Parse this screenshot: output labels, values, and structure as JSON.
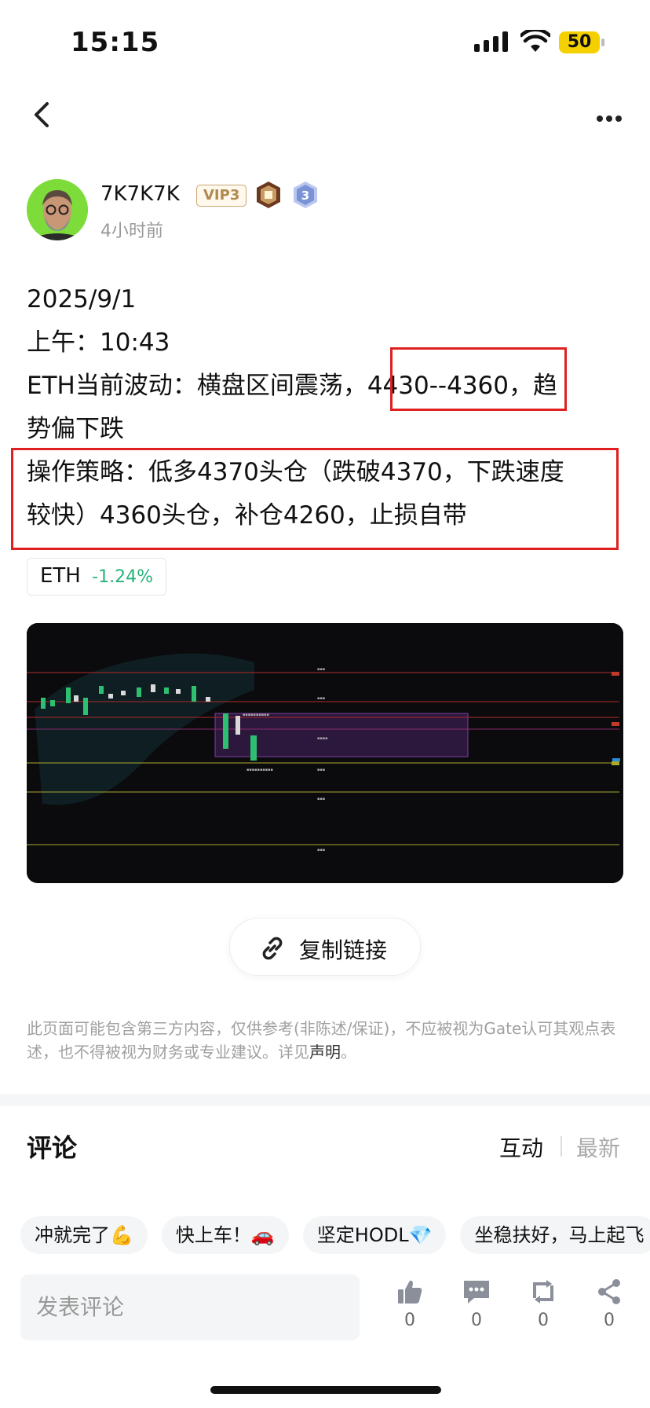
{
  "status_bar": {
    "time": "15:15",
    "battery": "50"
  },
  "author": {
    "name": "7K7K7K",
    "vip": "VIP3",
    "level": "3",
    "post_time": "4小时前"
  },
  "post": {
    "lines": [
      "2025/9/1",
      "上午：10:43",
      "ETH当前波动：横盘区间震荡，4430--4360，趋",
      "势偏下跌",
      "操作策略：低多4370头仓（跌破4370，下跌速度",
      "较快）4360头仓，补仓4260，止损自带"
    ]
  },
  "coin_tag": {
    "symbol": "ETH",
    "change": "-1.24%"
  },
  "copy_link": "复制链接",
  "disclaimer": {
    "text": "此页面可能包含第三方内容，仅供参考(非陈述/保证)，不应被视为Gate认可其观点表述，也不得被视为财务或专业建议。详见",
    "link": "声明",
    "end": "。"
  },
  "comments": {
    "title": "评论",
    "tab_active": "互动",
    "tab_inactive": "最新"
  },
  "quick_replies": [
    "冲就完了💪",
    "快上车！🚗",
    "坚定HODL💎",
    "坐稳扶好，马上起飞"
  ],
  "bottom_bar": {
    "input_placeholder": "发表评论",
    "like_count": "0",
    "comment_count": "0",
    "repost_count": "0",
    "share_count": "0"
  },
  "colors": {
    "highlight_box": "#e02020",
    "positive": "#28b27a",
    "vip_gold": "#b08a50"
  },
  "icons": [
    "back-icon",
    "more-icon",
    "link-icon",
    "thumb-up-icon",
    "comment-icon",
    "repost-icon",
    "share-icon"
  ]
}
